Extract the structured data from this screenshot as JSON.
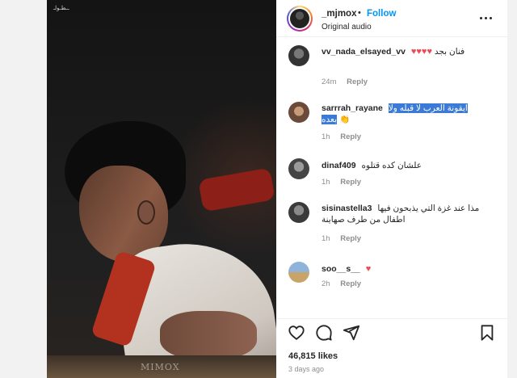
{
  "video": {
    "corner_mark": "ــطـولـ",
    "watermark": "MIMOX"
  },
  "post": {
    "username": "_mjmox",
    "separator": "•",
    "follow_label": "Follow",
    "audio_label": "Original audio"
  },
  "comments": [
    {
      "user": "vv_nada_elsayed_vv",
      "text": "فنان بجد",
      "time": "24m",
      "reply": "Reply",
      "hearts": "♥♥♥♥"
    },
    {
      "user": "sarrrah_rayane",
      "text_line1": "ايقونة العرب لا قبله ولا",
      "text_line2": "بعده",
      "emoji": "👏",
      "time": "1h",
      "reply": "Reply"
    },
    {
      "user": "dinaf409",
      "text": "علشان كده قتلوه",
      "time": "1h",
      "reply": "Reply"
    },
    {
      "user": "sisinastella3",
      "text_line1": "مذا عند غزة التي يذبحون فيها",
      "text_line2": "اطفال من طرف صهاينة",
      "time": "1h",
      "reply": "Reply"
    },
    {
      "user": "soo__s__",
      "hearts": "♥",
      "time": "2h",
      "reply": "Reply"
    }
  ],
  "footer": {
    "likes": "46,815 likes",
    "date": "3 days ago"
  }
}
